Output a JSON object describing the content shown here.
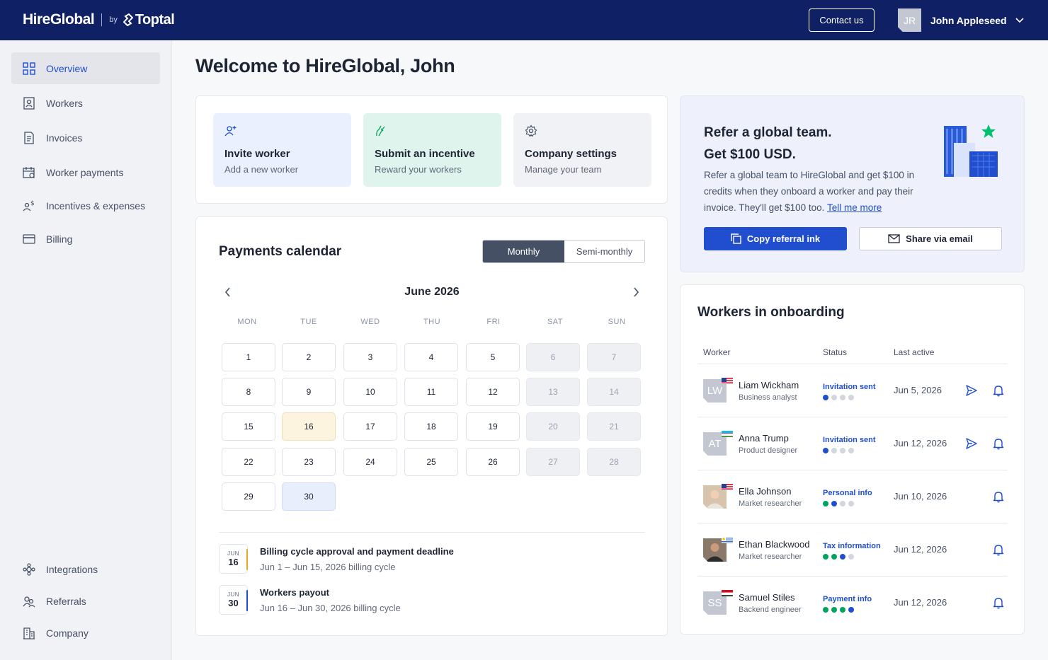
{
  "header": {
    "logo_main": "HireGlobal",
    "logo_by": "by",
    "logo_partner": "Toptal",
    "contact_label": "Contact us",
    "user_initials": "JR",
    "user_name": "John Appleseed"
  },
  "sidebar": {
    "top_items": [
      {
        "label": "Overview",
        "icon": "grid-icon",
        "active": true
      },
      {
        "label": "Workers",
        "icon": "person-card-icon"
      },
      {
        "label": "Invoices",
        "icon": "document-icon"
      },
      {
        "label": "Worker payments",
        "icon": "calendar-money-icon"
      },
      {
        "label": "Incentives & expenses",
        "icon": "person-dollar-icon"
      },
      {
        "label": "Billing",
        "icon": "credit-card-icon"
      }
    ],
    "bottom_items": [
      {
        "label": "Integrations",
        "icon": "puzzle-icon"
      },
      {
        "label": "Referrals",
        "icon": "people-icon"
      },
      {
        "label": "Company",
        "icon": "building-icon"
      }
    ]
  },
  "page_title": "Welcome to HireGlobal, John",
  "quick_actions": [
    {
      "title": "Invite worker",
      "subtitle": "Add a new worker",
      "icon": "add-person-icon",
      "bg": "#eaf0fd"
    },
    {
      "title": "Submit an incentive",
      "subtitle": "Reward your workers",
      "icon": "hand-icon",
      "bg": "#dff4ec"
    },
    {
      "title": "Company settings",
      "subtitle": "Manage your team",
      "icon": "gear-icon",
      "bg": "#f1f2f5"
    }
  ],
  "calendar": {
    "title": "Payments calendar",
    "toggle": {
      "monthly": "Monthly",
      "semi_monthly": "Semi-monthly",
      "selected": "Monthly"
    },
    "month_label": "June 2026",
    "weekdays": [
      "MON",
      "TUE",
      "WED",
      "THU",
      "FRI",
      "SAT",
      "SUN"
    ],
    "days": [
      "1",
      "2",
      "3",
      "4",
      "5",
      "6",
      "7",
      "8",
      "9",
      "10",
      "11",
      "12",
      "13",
      "14",
      "15",
      "16",
      "17",
      "18",
      "19",
      "20",
      "21",
      "22",
      "23",
      "24",
      "25",
      "26",
      "27",
      "28",
      "29",
      "30"
    ],
    "highlight_today": "16",
    "highlight_payout": "30",
    "events": [
      {
        "month": "JUN",
        "day": "16",
        "title": "Billing cycle approval and payment deadline",
        "subtitle": "Jun 1 – Jun 15, 2026 billing cycle",
        "color": "#e5a823"
      },
      {
        "month": "JUN",
        "day": "30",
        "title": "Workers payout",
        "subtitle": "Jun 16 – Jun 30, 2026 billing cycle",
        "color": "#204ecf"
      }
    ]
  },
  "referral": {
    "title_line1": "Refer a global team.",
    "title_line2": "Get $100 USD.",
    "body": "Refer a global team to HireGlobal and get $100 in credits when they onboard a worker and pay their invoice. They'll get $100 too.",
    "link": "Tell me more",
    "copy_label": "Copy referral ink",
    "share_label": "Share via email"
  },
  "onboarding": {
    "title": "Workers in onboarding",
    "columns": [
      "Worker",
      "Status",
      "Last active"
    ],
    "rows": [
      {
        "initials": "LW",
        "name": "Liam Wickham",
        "role": "Business analyst",
        "status": "Invitation sent",
        "progress": 1,
        "last_active": "Jun 5, 2026",
        "flag": "us",
        "send": true,
        "photo": false
      },
      {
        "initials": "AT",
        "name": "Anna Trump",
        "role": "Product designer",
        "status": "Invitation sent",
        "progress": 1,
        "last_active": "Jun 12, 2026",
        "flag": "uz",
        "send": true,
        "photo": false
      },
      {
        "initials": "",
        "name": "Ella Johnson",
        "role": "Market researcher",
        "status": "Personal info",
        "progress": 2,
        "last_active": "Jun 10, 2026",
        "flag": "us",
        "send": false,
        "photo": true
      },
      {
        "initials": "",
        "name": "Ethan Blackwood",
        "role": "Market researcher",
        "status": "Tax information",
        "progress": 3,
        "last_active": "Jun 12, 2026",
        "flag": "uy",
        "send": false,
        "photo": true
      },
      {
        "initials": "SS",
        "name": "Samuel Stiles",
        "role": "Backend engineer",
        "status": "Payment info",
        "progress": 4,
        "last_active": "Jun 12, 2026",
        "flag": "eg",
        "send": false,
        "photo": false
      }
    ]
  },
  "colors": {
    "header_bg": "#0f2164",
    "accent": "#204ecf",
    "success": "#00a45c"
  }
}
